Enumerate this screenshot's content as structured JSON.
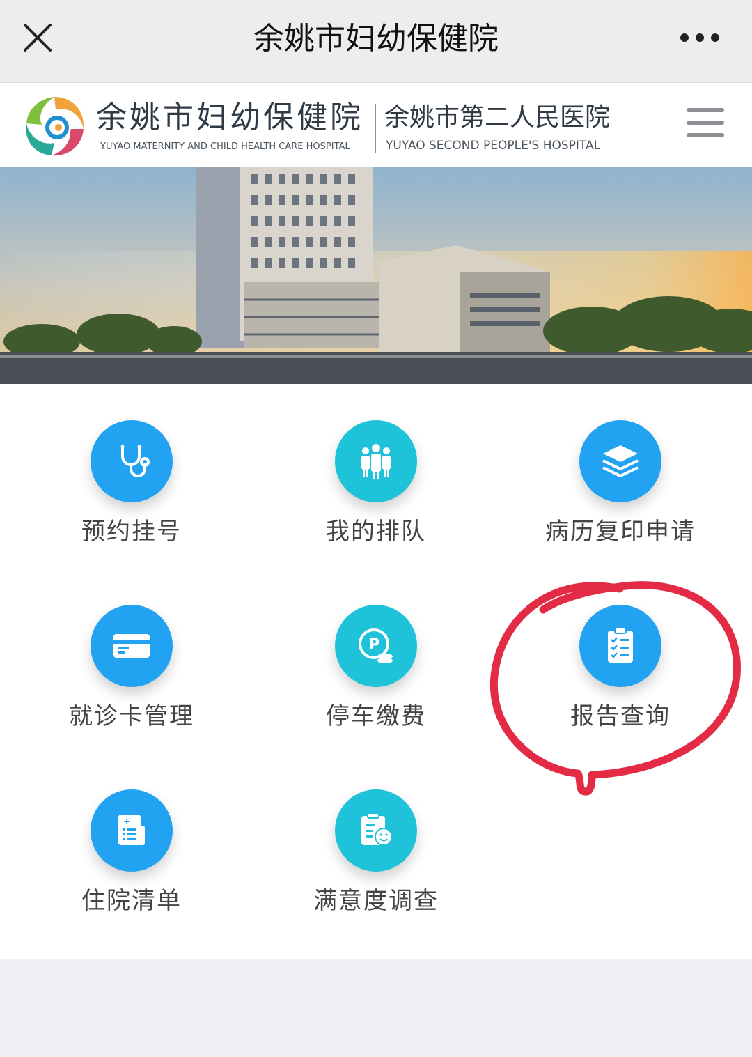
{
  "topbar": {
    "title": "余姚市妇幼保健院",
    "close_icon": "close-icon",
    "more_icon": "more-dots-icon"
  },
  "brand": {
    "name_cn": "余姚市妇幼保健院",
    "name_en": "YUYAO MATERNITY AND CHILD HEALTH CARE HOSPITAL",
    "name2_cn": "余姚市第二人民医院",
    "name2_en": "YUYAO SECOND PEOPLE'S HOSPITAL",
    "menu_icon": "hamburger-menu-icon"
  },
  "services": [
    {
      "label": "预约挂号",
      "icon": "stethoscope-icon",
      "color": "#22a3f2"
    },
    {
      "label": "我的排队",
      "icon": "queue-people-icon",
      "color": "#1fc3d9"
    },
    {
      "label": "病历复印申请",
      "icon": "layers-icon",
      "color": "#22a3f2"
    },
    {
      "label": "就诊卡管理",
      "icon": "card-icon",
      "color": "#22a3f2"
    },
    {
      "label": "停车缴费",
      "icon": "parking-coin-icon",
      "color": "#1fc3d9"
    },
    {
      "label": "报告查询",
      "icon": "clipboard-checklist-icon",
      "color": "#22a3f2"
    },
    {
      "label": "住院清单",
      "icon": "document-list-icon",
      "color": "#22a3f2"
    },
    {
      "label": "满意度调查",
      "icon": "survey-smile-icon",
      "color": "#1fc3d9"
    }
  ],
  "colors": {
    "accent_blue": "#22a3f2",
    "accent_teal": "#1fc3d9",
    "annotation_red": "#e32b45"
  }
}
